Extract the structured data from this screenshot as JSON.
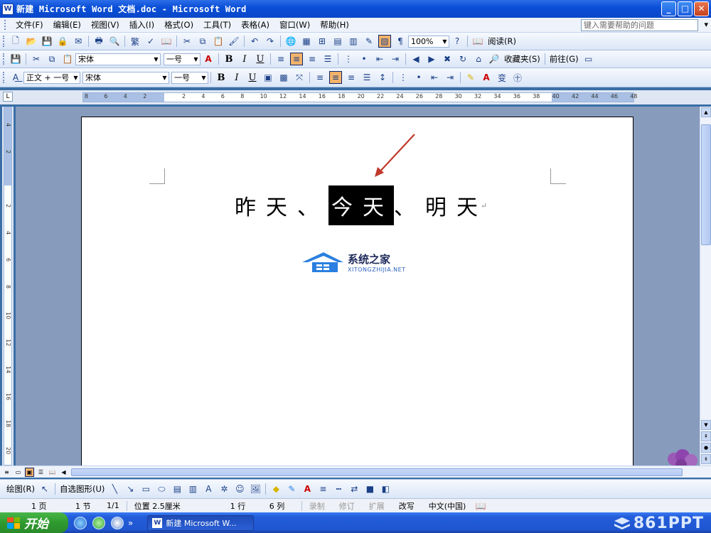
{
  "window": {
    "title": "新建 Microsoft Word 文档.doc - Microsoft Word",
    "app_icon_letter": "W",
    "minimize": "_",
    "maximize": "□",
    "close": "✕"
  },
  "menubar": {
    "items": [
      "文件(F)",
      "编辑(E)",
      "视图(V)",
      "插入(I)",
      "格式(O)",
      "工具(T)",
      "表格(A)",
      "窗口(W)",
      "帮助(H)"
    ],
    "help_placeholder": "键入需要帮助的问题",
    "close_glyph": "▾"
  },
  "toolbar1": {
    "zoom": "100%",
    "read_label": "阅读(R)"
  },
  "toolbar2": {
    "font": "宋体",
    "size": "一号",
    "favorites": "收藏夹(S)",
    "goto": "前往(G)"
  },
  "toolbar3": {
    "style": "正文 + 一号",
    "font": "宋体",
    "size": "一号"
  },
  "ruler": {
    "corner": "L",
    "h_ticks": [
      "8",
      "6",
      "4",
      "2",
      "",
      "2",
      "4",
      "6",
      "8",
      "10",
      "12",
      "14",
      "16",
      "18",
      "20",
      "22",
      "24",
      "26",
      "28",
      "30",
      "32",
      "34",
      "36",
      "38",
      "40",
      "42",
      "44",
      "46",
      "48"
    ],
    "v_ticks": [
      "4",
      "2",
      "",
      "2",
      "4",
      "6",
      "8",
      "10",
      "12",
      "14",
      "16",
      "18",
      "20"
    ]
  },
  "document": {
    "text_before": "昨天、",
    "selected_text": "今天",
    "text_after": "、明天",
    "pilcrow": "↵"
  },
  "watermark": {
    "title": "系统之家",
    "url": "XITONGZHIJIA.NET"
  },
  "drawbar": {
    "draw_label": "绘图(R)",
    "autoshapes_label": "自选图形(U)"
  },
  "statusbar": {
    "page": "1 页",
    "section": "1 节",
    "page_of": "1/1",
    "position": "位置 2.5厘米",
    "line": "1 行",
    "column": "6 列",
    "rec": "录制",
    "trk": "修订",
    "ext": "扩展",
    "ovr": "改写",
    "language": "中文(中国)"
  },
  "taskbar": {
    "start": "开始",
    "task_item": "新建 Microsoft W...",
    "task_icon_letter": "W",
    "more": "»"
  },
  "corner_brand": "861PPT",
  "colors": {
    "title_blue": "#0b4fd8",
    "selection": "#000000",
    "arrow": "#c0392b",
    "start_green": "#2e9a2e"
  }
}
